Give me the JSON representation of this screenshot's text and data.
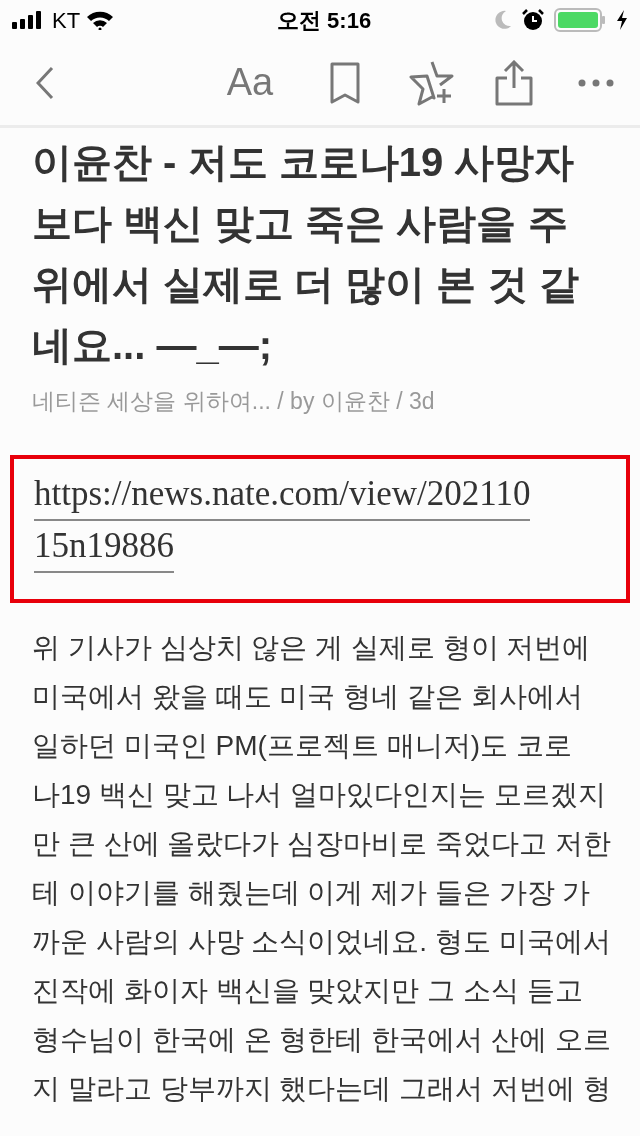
{
  "status_bar": {
    "carrier": "KT",
    "time": "오전 5:16"
  },
  "toolbar": {
    "font_button": "Aa"
  },
  "article": {
    "title_lines": [
      "이윤찬 - 저도 코로나19 사망자",
      "보다 백신 맞고 죽은 사람을 주",
      "위에서 실제로 더 많이 본 것 같",
      "네요... —_—;"
    ],
    "meta": "네티즌 세상을 위하여... / by 이윤찬 / 3d",
    "link_lines": [
      "https://news.nate.com/view/202110",
      "15n19886"
    ],
    "body_lines": [
      "위 기사가 심상치 않은 게 실제로 형이 저번에",
      "미국에서 왔을 때도 미국 형네 같은 회사에서",
      "일하던 미국인 PM(프로젝트 매니저)도 코로",
      "나19 백신 맞고 나서 얼마있다인지는 모르겠지",
      "만 큰 산에 올랐다가 심장마비로 죽었다고 저한",
      "테 이야기를 해줬는데 이게 제가 들은 가장 가",
      "까운 사람의 사망 소식이었네요. 형도 미국에서",
      "진작에 화이자 백신을 맞았지만 그 소식 듣고",
      "형수님이 한국에 온 형한테 한국에서 산에 오르",
      "지 말라고 당부까지 했다는데 그래서 저번에 형"
    ]
  }
}
